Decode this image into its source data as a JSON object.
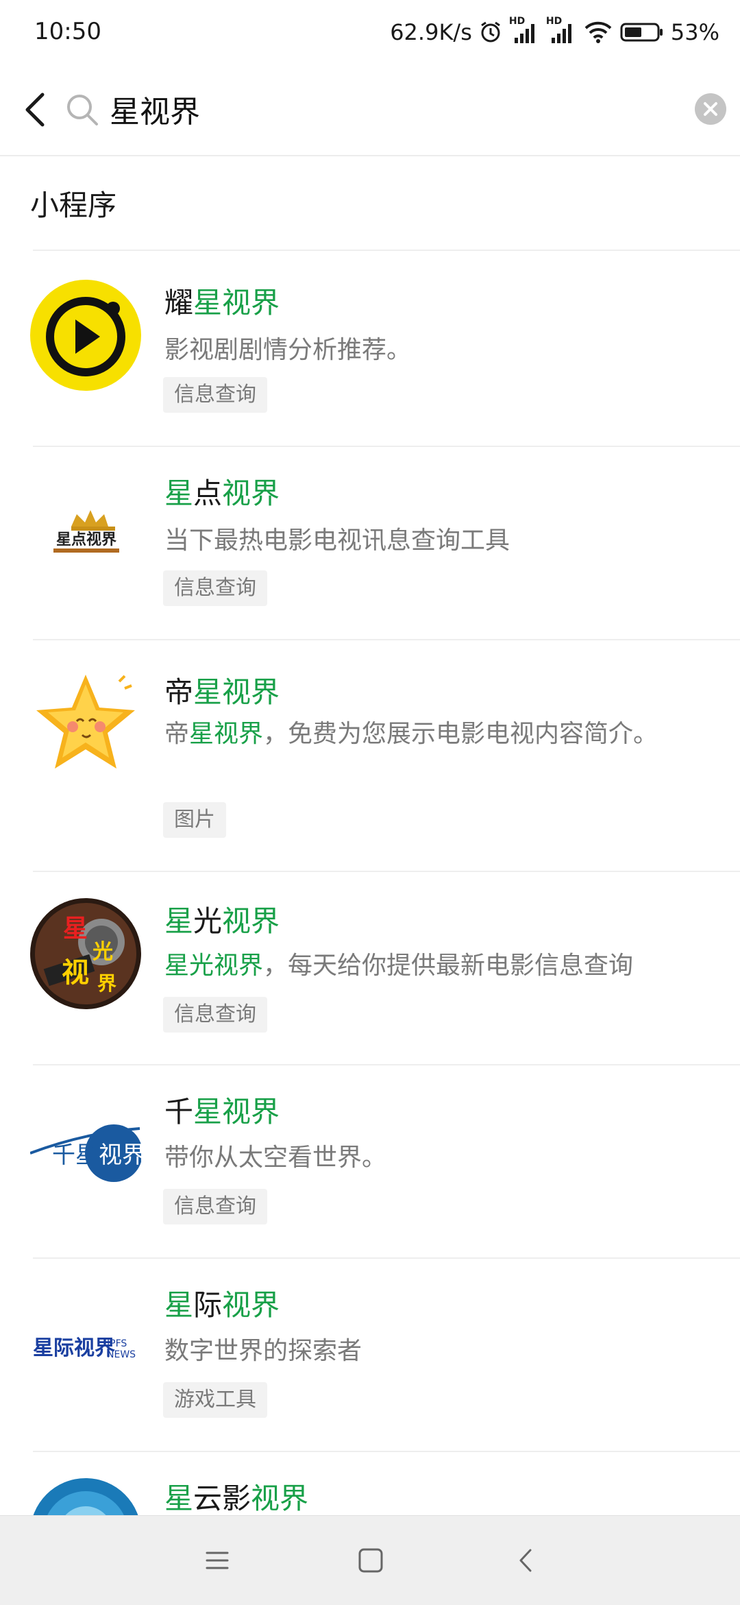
{
  "status_bar": {
    "time": "10:50",
    "net_speed": "62.9K/s",
    "hd1": "HD",
    "hd2": "HD",
    "battery": "53%"
  },
  "search": {
    "query": "星视界",
    "icons": {
      "back": "back-chevron-icon",
      "search": "search-icon",
      "clear": "clear-icon"
    }
  },
  "section": {
    "title": "小程序"
  },
  "results": [
    {
      "name_pre": "耀",
      "name_hl": "星视界",
      "name_mid": "",
      "name_hl2": "",
      "desc": "影视剧剧情分析推荐。",
      "desc_hl": "",
      "tag": "信息查询",
      "logo": "play-logo"
    },
    {
      "name_pre": "",
      "name_hl": "星",
      "name_mid": "点",
      "name_hl2": "视界",
      "desc": "当下最热电影电视讯息查询工具",
      "desc_hl": "",
      "tag": "信息查询",
      "logo": "crown-logo",
      "logo_text": "星点视界"
    },
    {
      "name_pre": "帝",
      "name_hl": "星视界",
      "name_mid": "",
      "name_hl2": "",
      "desc_pre": "帝",
      "desc_hl": "星视界",
      "desc": "，免费为您展示电影电视内容简介。",
      "tag": "图片",
      "logo": "star-logo"
    },
    {
      "name_pre": "",
      "name_hl": "星",
      "name_mid": "光",
      "name_hl2": "视界",
      "desc_pre": "",
      "desc_hl": "星光视界",
      "desc": "，每天给你提供最新电影信息查询",
      "tag": "信息查询",
      "logo": "film-logo",
      "logo_text": "星光视界"
    },
    {
      "name_pre": "千",
      "name_hl": "星视界",
      "name_mid": "",
      "name_hl2": "",
      "desc": "带你从太空看世界。",
      "desc_hl": "",
      "tag": "信息查询",
      "logo": "globe-logo",
      "logo_text": "千星视界"
    },
    {
      "name_pre": "",
      "name_hl": "星",
      "name_mid": "际",
      "name_hl2": "视界",
      "desc": "数字世界的探索者",
      "desc_hl": "",
      "tag": "游戏工具",
      "logo": "ipfs-logo",
      "logo_text": "星际视界",
      "logo_sub1": "IPFS",
      "logo_sub2": "NEWS"
    },
    {
      "name_pre": "",
      "name_hl": "星",
      "name_mid": "云影",
      "name_hl2": "视界",
      "desc": "",
      "desc_hl": "",
      "tag": "",
      "logo": "cloud-logo"
    }
  ],
  "nav": {
    "menu": "menu-icon",
    "home": "home-icon",
    "back": "back-icon"
  },
  "colors": {
    "highlight": "#18a048",
    "tag_bg": "#f2f2f2"
  }
}
